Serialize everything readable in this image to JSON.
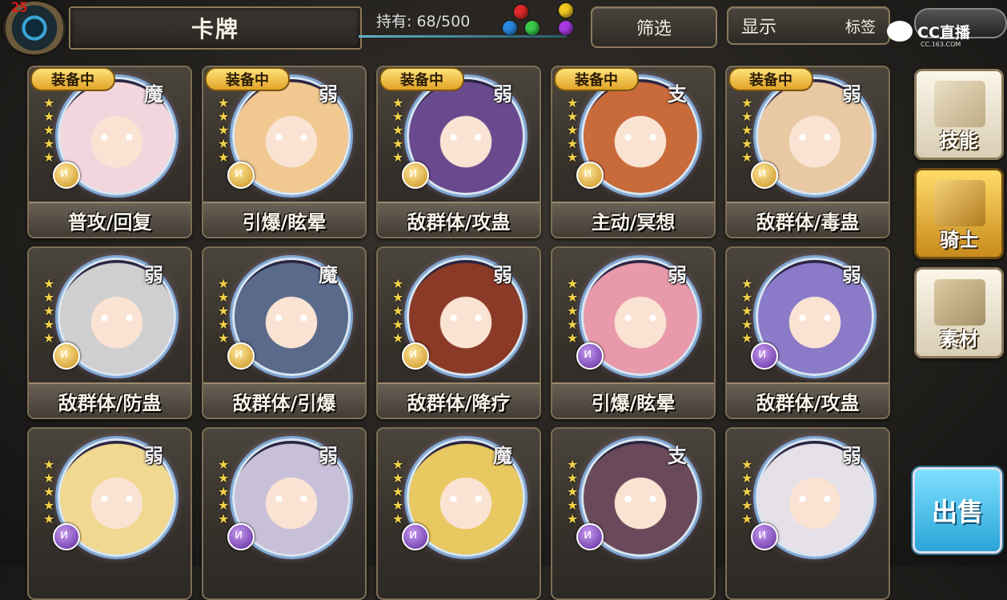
{
  "fps": "25",
  "header": {
    "title": "卡牌",
    "held": "持有: 68/500"
  },
  "buttons": {
    "filter": "筛选",
    "display": "显示",
    "display_sub": "标签"
  },
  "live_logo": {
    "name": "CC直播",
    "url": "CC.163.COM"
  },
  "sidebar": {
    "skill": "技能",
    "knight": "骑士",
    "material": "素材",
    "sell": "出售"
  },
  "equip_badge": "装备中",
  "cards": [
    {
      "cls": "魔",
      "label": "普攻/回复",
      "equipped": true,
      "medal": "gold",
      "tint": "#f3d6dd"
    },
    {
      "cls": "弱",
      "label": "引爆/眩晕",
      "equipped": true,
      "medal": "gold",
      "tint": "#f0c890"
    },
    {
      "cls": "弱",
      "label": "敌群体/攻蛊",
      "equipped": true,
      "medal": "gold",
      "tint": "#6a4a8e"
    },
    {
      "cls": "支",
      "label": "主动/冥想",
      "equipped": true,
      "medal": "gold",
      "tint": "#c86a3a"
    },
    {
      "cls": "弱",
      "label": "敌群体/毒蛊",
      "equipped": true,
      "medal": "gold",
      "tint": "#e9c9a4"
    },
    {
      "cls": "弱",
      "label": "敌群体/防蛊",
      "equipped": false,
      "medal": "gold",
      "tint": "#cfcfcf"
    },
    {
      "cls": "魔",
      "label": "敌群体/引爆",
      "equipped": false,
      "medal": "gold",
      "tint": "#5a6a8a"
    },
    {
      "cls": "弱",
      "label": "敌群体/降疗",
      "equipped": false,
      "medal": "gold",
      "tint": "#8a3a26"
    },
    {
      "cls": "弱",
      "label": "引爆/眩晕",
      "equipped": false,
      "medal": "purple",
      "tint": "#e89aaa"
    },
    {
      "cls": "弱",
      "label": "敌群体/攻蛊",
      "equipped": false,
      "medal": "purple",
      "tint": "#8a7ac8"
    },
    {
      "cls": "弱",
      "label": "",
      "equipped": false,
      "medal": "purple",
      "tint": "#f0d890"
    },
    {
      "cls": "弱",
      "label": "",
      "equipped": false,
      "medal": "purple",
      "tint": "#c8c0d8"
    },
    {
      "cls": "魔",
      "label": "",
      "equipped": false,
      "medal": "purple",
      "tint": "#e8c860"
    },
    {
      "cls": "支",
      "label": "",
      "equipped": false,
      "medal": "purple",
      "tint": "#6a4a5a"
    },
    {
      "cls": "弱",
      "label": "",
      "equipped": false,
      "medal": "purple",
      "tint": "#e6e0e8"
    }
  ]
}
